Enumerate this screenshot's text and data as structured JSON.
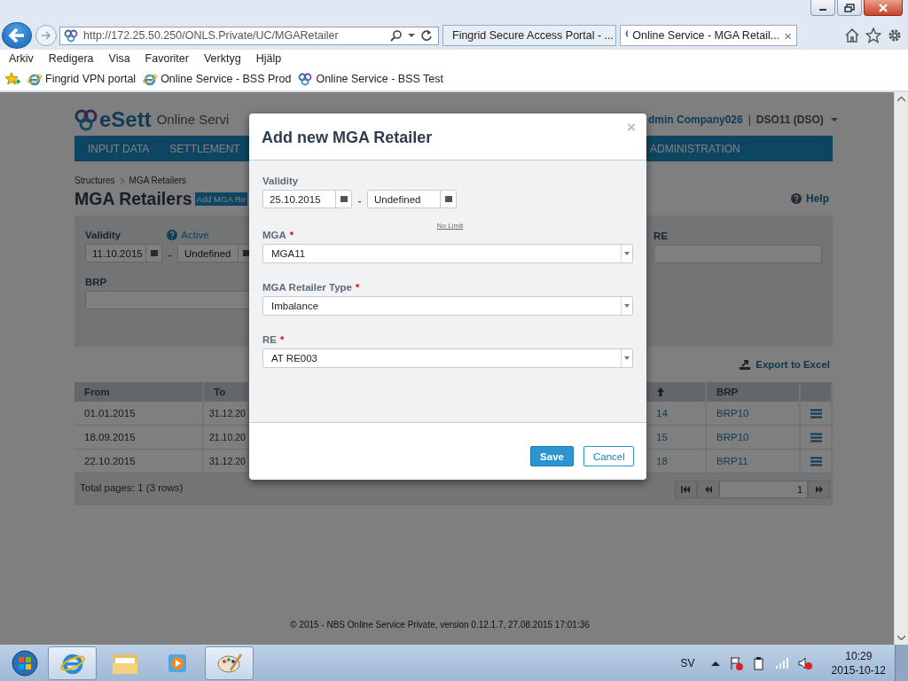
{
  "browser": {
    "address": "http://172.25.50.250/ONLS.Private/UC/MGARetailer",
    "tabs": [
      {
        "title": "Fingrid Secure Access Portal - ...",
        "kind": "ie",
        "selected": false
      },
      {
        "title": "Online Service - MGA Retail...",
        "kind": "esett",
        "selected": true,
        "close": "×"
      }
    ],
    "menu": [
      "Arkiv",
      "Redigera",
      "Visa",
      "Favoriter",
      "Verktyg",
      "Hjälp"
    ],
    "favorites": [
      {
        "label": "Fingrid VPN portal",
        "kind": "ie"
      },
      {
        "label": "Online Service - BSS Prod",
        "kind": "ie"
      },
      {
        "label": "Online Service - BSS Test",
        "kind": "esett"
      }
    ]
  },
  "header": {
    "logo": "eSett",
    "app_name": "Online Servi",
    "user": "dmin Company026",
    "separator": "|",
    "role": "DSO11 (DSO)"
  },
  "nav": [
    {
      "label": "INPUT DATA"
    },
    {
      "label": "SETTLEMENT"
    },
    {
      "label": "ADMINISTRATION"
    }
  ],
  "breadcrumb": [
    "Structures",
    "MGA Retailers"
  ],
  "page_title": "MGA Retailers",
  "add_button": "Add MGA Re",
  "help": "Help",
  "filter": {
    "validity_label": "Validity",
    "from": "11.10.2015",
    "separator": "-",
    "to": "Undefined",
    "active_label": "Active",
    "brp_label": "BRP",
    "re_label": "RE"
  },
  "export": "Export to Excel",
  "table": {
    "columns": {
      "from": "From",
      "to": "To",
      "brp": "BRP"
    },
    "rows": [
      {
        "from": "01.01.2015",
        "to": "31.12.20",
        "column_4": "14",
        "brp": "BRP10"
      },
      {
        "from": "18.09.2015",
        "to": "21.10.20",
        "column_4": "15",
        "brp": "BRP10"
      },
      {
        "from": "22.10.2015",
        "to": "31.12.20",
        "column_4": "18",
        "brp": "BRP11"
      }
    ],
    "summary": "Total pages: 1 (3 rows)",
    "page": "1"
  },
  "modal": {
    "title": "Add new MGA Retailer",
    "close": "×",
    "validity_label": "Validity",
    "from": "25.10.2015",
    "separator": "-",
    "to": "Undefined",
    "no_limit": "No Limit",
    "fields": [
      {
        "label": "MGA",
        "required_mark": "*",
        "value": "MGA11"
      },
      {
        "label": "MGA Retailer Type",
        "required_mark": "*",
        "value": "Imbalance"
      },
      {
        "label": "RE",
        "required_mark": "*",
        "value": "AT RE003"
      }
    ],
    "buttons": [
      {
        "label": "Save",
        "kind": "primary"
      },
      {
        "label": "Cancel",
        "kind": "secondary"
      }
    ]
  },
  "copyright": "© 2015 - NBS Online Service Private, version 0.12.1.7, 27.08.2015 17:01:36",
  "taskbar": {
    "language": "SV",
    "time": "10:29",
    "date": "2015-10-12"
  }
}
